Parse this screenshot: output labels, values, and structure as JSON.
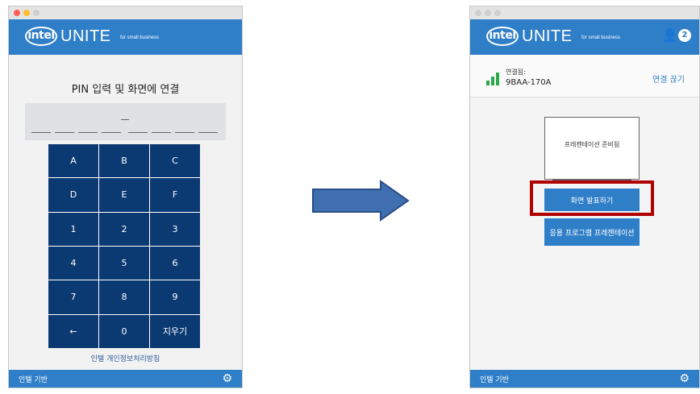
{
  "left_window": {
    "header": {
      "brand": "intel",
      "product": "UNITE",
      "tagline": "for small business"
    },
    "title": "PIN 입력 및 화면에 연결",
    "keypad": [
      "A",
      "B",
      "C",
      "D",
      "E",
      "F",
      "1",
      "2",
      "3",
      "4",
      "5",
      "6",
      "7",
      "8",
      "9",
      "←",
      "0",
      "지우기"
    ],
    "privacy_link": "인텔 개인정보처리방침",
    "footer": {
      "label": "인텔 기반"
    }
  },
  "right_window": {
    "header": {
      "brand": "intel",
      "product": "UNITE",
      "tagline": "for small business",
      "badge": "2"
    },
    "status": {
      "label": "연결됨:",
      "device_id": "9BAA-170A",
      "disconnect": "연결 끊기"
    },
    "preview_text": "프레젠테이션 준비됨",
    "present_button": "화면 발표하기",
    "app_button": "응용 프로그램 프레젠테이션",
    "footer": {
      "label": "인텔 기반"
    }
  },
  "colors": {
    "header_blue": "#2f7fc8",
    "keypad_blue": "#0b3a72",
    "highlight_red": "#b00000",
    "signal_green": "#2aa84a",
    "arrow_blue": "#3f6fb0"
  }
}
